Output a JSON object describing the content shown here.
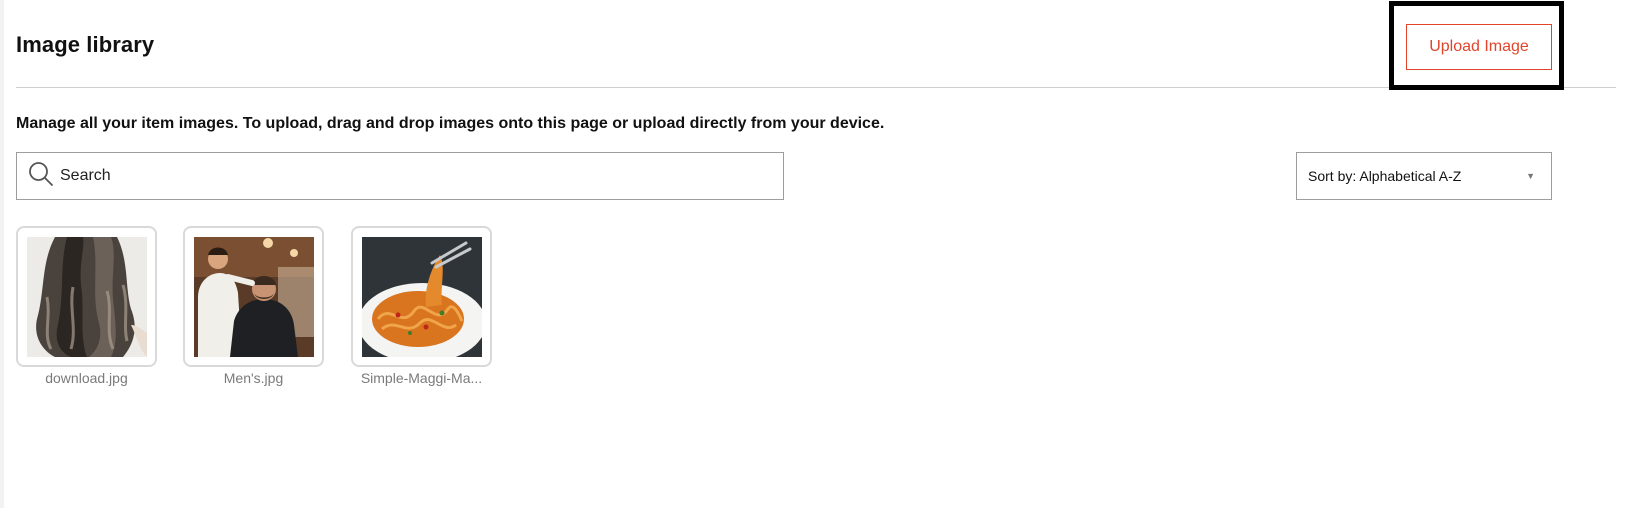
{
  "header": {
    "title": "Image library",
    "upload_label": "Upload Image"
  },
  "description": "Manage all your item images. To upload, drag and drop images onto this page or upload directly from your device.",
  "search": {
    "placeholder": "Search",
    "value": ""
  },
  "sort": {
    "selected": "Sort by: Alphabetical A-Z"
  },
  "images": [
    {
      "filename": "download.jpg",
      "subject": "long wavy ombre hair"
    },
    {
      "filename": "Men's.jpg",
      "subject": "barber shop haircut"
    },
    {
      "filename": "Simple-Maggi-Ma...",
      "subject": "plate of noodles"
    }
  ],
  "colors": {
    "accent": "#e0452c",
    "border": "#9d9d9d",
    "card_border": "#d9d9d9",
    "label_text": "#7a7a7a",
    "highlight": "#000000"
  },
  "icons": {
    "search": "search-icon",
    "sort_toggle": "chevron-down-icon"
  }
}
